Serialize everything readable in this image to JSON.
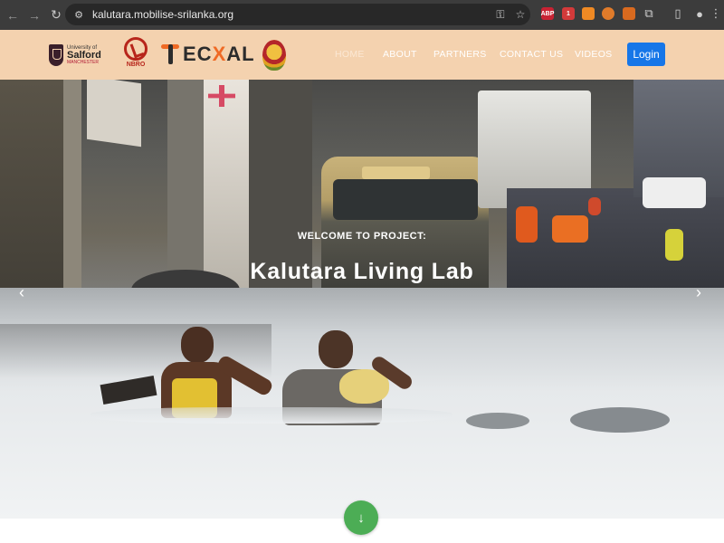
{
  "browser": {
    "url": "kalutara.mobilise-srilanka.org",
    "extensions": [
      {
        "name": "adblock-plus-extension",
        "text": "ABP",
        "color": "#c82333"
      },
      {
        "name": "extension-2",
        "text": "1",
        "color": "#d33a3a"
      },
      {
        "name": "extension-3",
        "text": "",
        "color": "#f08a24"
      },
      {
        "name": "extension-4",
        "text": "",
        "color": "#e07b2a"
      },
      {
        "name": "extension-5",
        "text": "",
        "color": "#d96a1f"
      }
    ]
  },
  "header": {
    "logos": {
      "salford": {
        "line1": "University of",
        "line2": "Salford",
        "line3": "MANCHESTER"
      },
      "nbro": {
        "text": "NBRO"
      },
      "tecxal": {
        "pre": "TEC",
        "x": "X",
        "post": "AL"
      }
    },
    "nav": [
      {
        "label": "HOME",
        "active": true
      },
      {
        "label": "ABOUT",
        "active": false
      },
      {
        "label": "PARTNERS",
        "active": false
      },
      {
        "label": "CONTACT US",
        "active": false
      },
      {
        "label": "VIDEOS",
        "active": false
      }
    ],
    "login_label": "Login"
  },
  "hero": {
    "welcome": "WELCOME TO PROJECT:",
    "title": "Kalutara Living Lab",
    "prev_icon": "‹",
    "next_icon": "›",
    "scroll_icon": "↓"
  },
  "icons": {
    "back": "←",
    "forward": "→",
    "reload": "↻",
    "site_info": "⚙",
    "key": "⚿",
    "star": "☆",
    "puzzle": "⧉",
    "sidepanel": "▯",
    "avatar": "●",
    "menu": "⋮"
  },
  "colors": {
    "header_bg": "#f4d2af",
    "login_bg": "#1676e8",
    "scroll_btn_bg": "#4cad55",
    "browser_bar": "#3c3c3c"
  }
}
